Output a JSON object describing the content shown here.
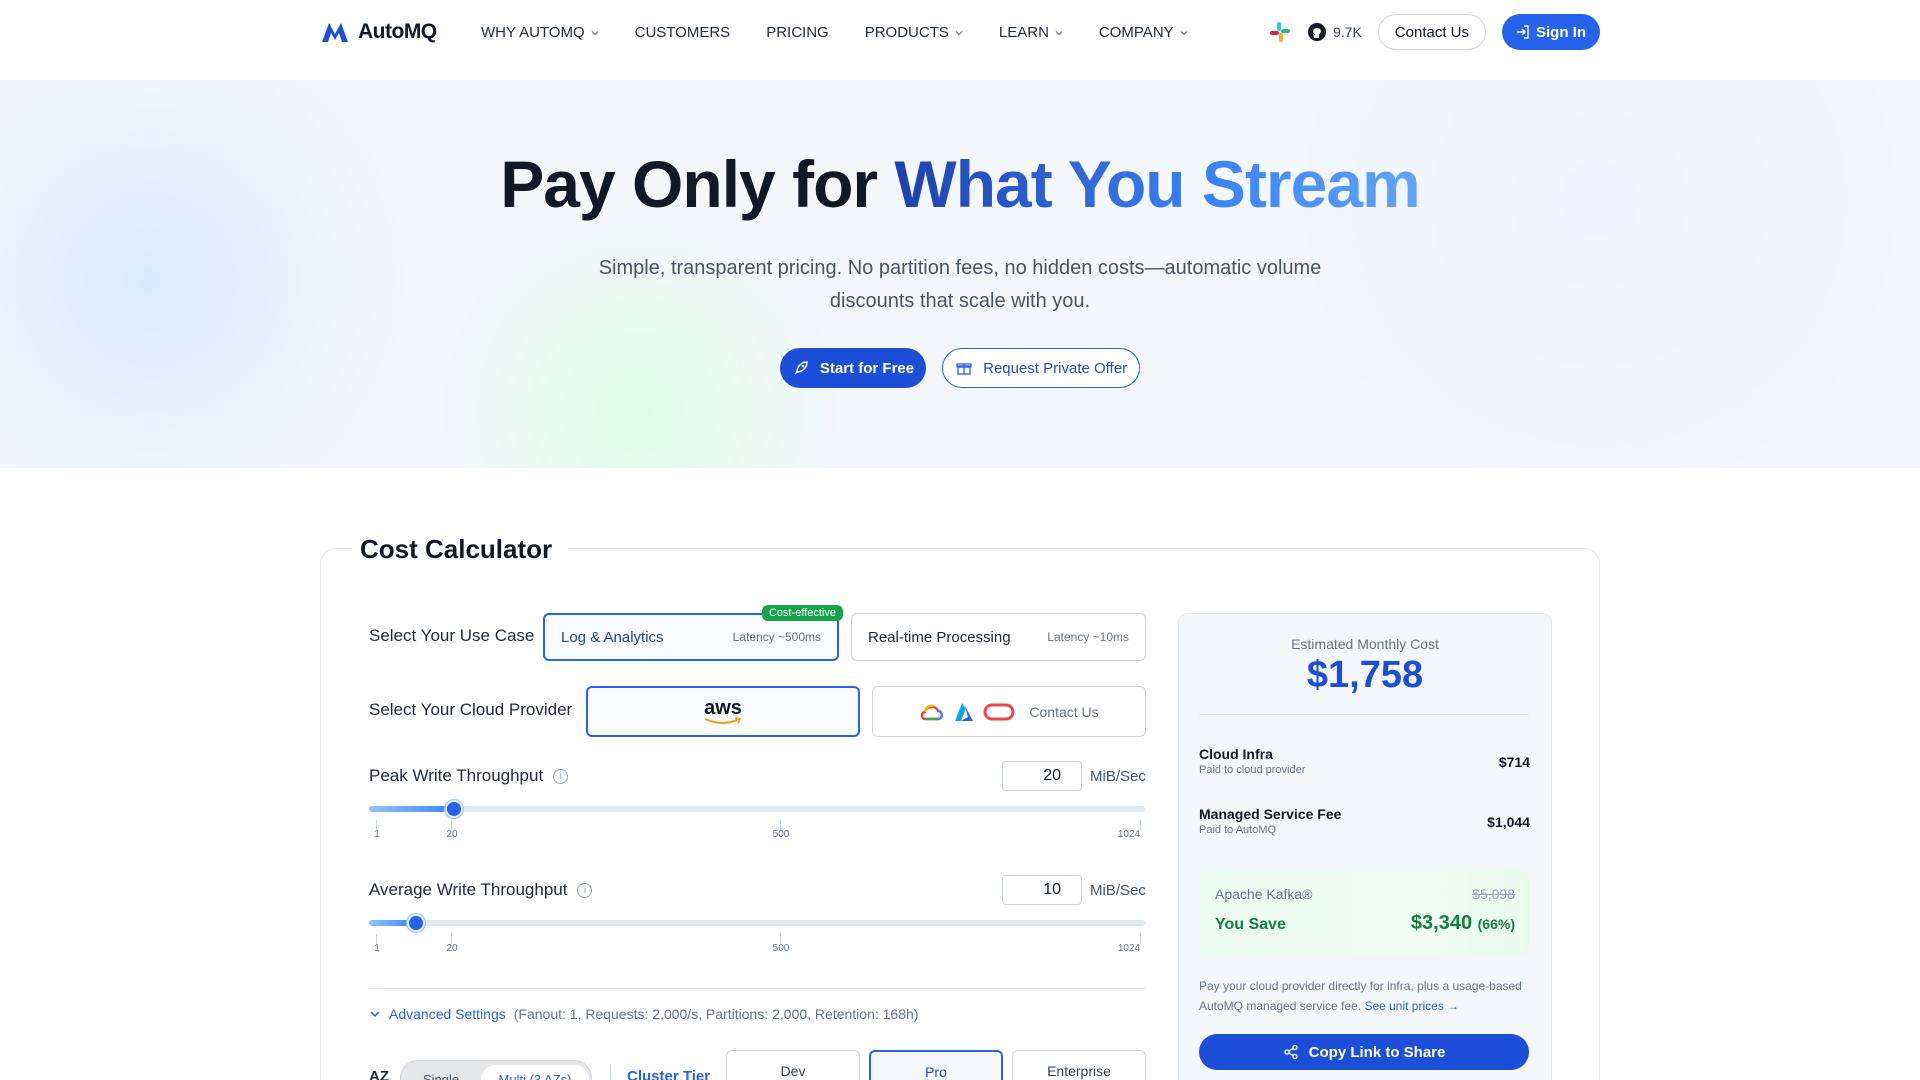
{
  "brand": {
    "name": "AutoMQ",
    "accent": "#2563eb"
  },
  "nav": {
    "items": [
      {
        "label": "WHY AUTOMQ",
        "has_menu": true
      },
      {
        "label": "CUSTOMERS",
        "has_menu": false
      },
      {
        "label": "PRICING",
        "has_menu": false
      },
      {
        "label": "PRODUCTS",
        "has_menu": true
      },
      {
        "label": "LEARN",
        "has_menu": true
      },
      {
        "label": "COMPANY",
        "has_menu": true
      }
    ],
    "github_stars": "9.7K",
    "contact_label": "Contact Us",
    "signin_label": "Sign In"
  },
  "hero": {
    "title_dark": "Pay Only for",
    "title_blue": "What You Stream",
    "subtitle": "Simple, transparent pricing. No partition fees, no hidden costs—automatic volume discounts that scale with you.",
    "cta_primary": "Start for Free",
    "cta_secondary": "Request Private Offer"
  },
  "calculator": {
    "title": "Cost Calculator",
    "use_case": {
      "label": "Select Your Use Case",
      "options": [
        {
          "name": "Log & Analytics",
          "latency": "Latency ~500ms",
          "badge": "Cost-effective",
          "selected": true
        },
        {
          "name": "Real-time Processing",
          "latency": "Latency ~10ms",
          "selected": false
        }
      ]
    },
    "cloud": {
      "label": "Select Your Cloud Provider",
      "options": [
        {
          "name": "aws",
          "selected": true
        },
        {
          "name": "Contact Us",
          "selected": false
        }
      ]
    },
    "peak": {
      "label": "Peak Write Throughput",
      "value": "20",
      "unit": "MiB/Sec",
      "slider_level": 0.11,
      "ticks": [
        "1",
        "20",
        "500",
        "1024"
      ]
    },
    "average": {
      "label": "Average Write Throughput",
      "value": "10",
      "unit": "MiB/Sec",
      "slider_level": 0.06,
      "ticks": [
        "1",
        "20",
        "500",
        "1024"
      ]
    },
    "advanced": {
      "label": "Advanced Settings",
      "params": "(Fanout: 1, Requests: 2,000/s, Partitions: 2,000, Retention: 168h)"
    },
    "az": {
      "label": "AZ",
      "options": [
        "Single",
        "Multi (3 AZs)"
      ],
      "selected": "Multi (3 AZs)"
    },
    "tier": {
      "label": "Cluster Tier",
      "options": [
        "Dev",
        "Pro",
        "Enterprise"
      ],
      "selected": "Pro"
    }
  },
  "summary": {
    "estimate_label": "Estimated Monthly Cost",
    "estimate_value": "$1,758",
    "lines": [
      {
        "name": "Cloud Infra",
        "sub": "Paid to cloud provider",
        "value": "$714"
      },
      {
        "name": "Managed Service Fee",
        "sub": "Paid to AutoMQ",
        "value": "$1,044"
      }
    ],
    "kafka_label": "Apache Kafka®",
    "kafka_value": "$5,098",
    "you_save_label": "You Save",
    "you_save_value": "$3,340",
    "you_save_pct": "(66%)",
    "note": "Pay your cloud provider directly for infra, plus a usage-based AutoMQ managed service fee.",
    "note_link": "See unit prices →",
    "share_label": "Copy Link to Share"
  }
}
